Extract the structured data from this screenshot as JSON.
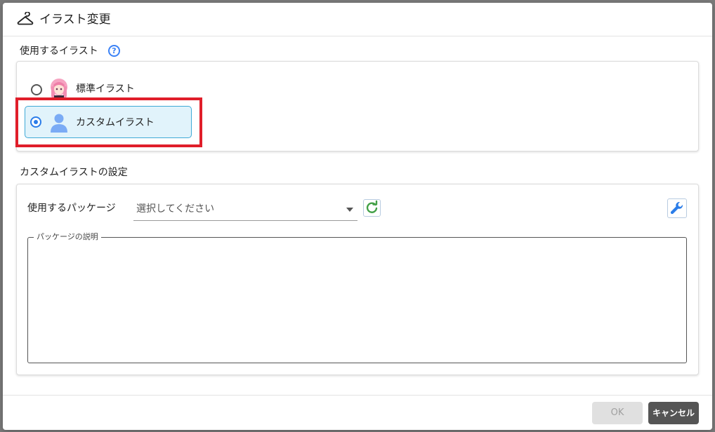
{
  "dialog": {
    "title": "イラスト変更",
    "icon": "hanger-icon"
  },
  "illust_section": {
    "label": "使用するイラスト",
    "help_icon": "?",
    "options": [
      {
        "label": "標準イラスト",
        "icon": "anime-character-icon",
        "selected": false
      },
      {
        "label": "カスタムイラスト",
        "icon": "person-icon",
        "selected": true
      }
    ]
  },
  "custom_section": {
    "label": "カスタムイラストの設定",
    "package_label": "使用するパッケージ",
    "package_placeholder": "選択してください",
    "description_legend": "パッケージの説明",
    "description_value": ""
  },
  "footer": {
    "ok_label": "OK",
    "cancel_label": "キャンセル"
  },
  "colors": {
    "accent": "#2b7de9",
    "selected_bg": "#e1f3fb",
    "highlight": "#e01e2a",
    "refresh": "#43a047"
  }
}
